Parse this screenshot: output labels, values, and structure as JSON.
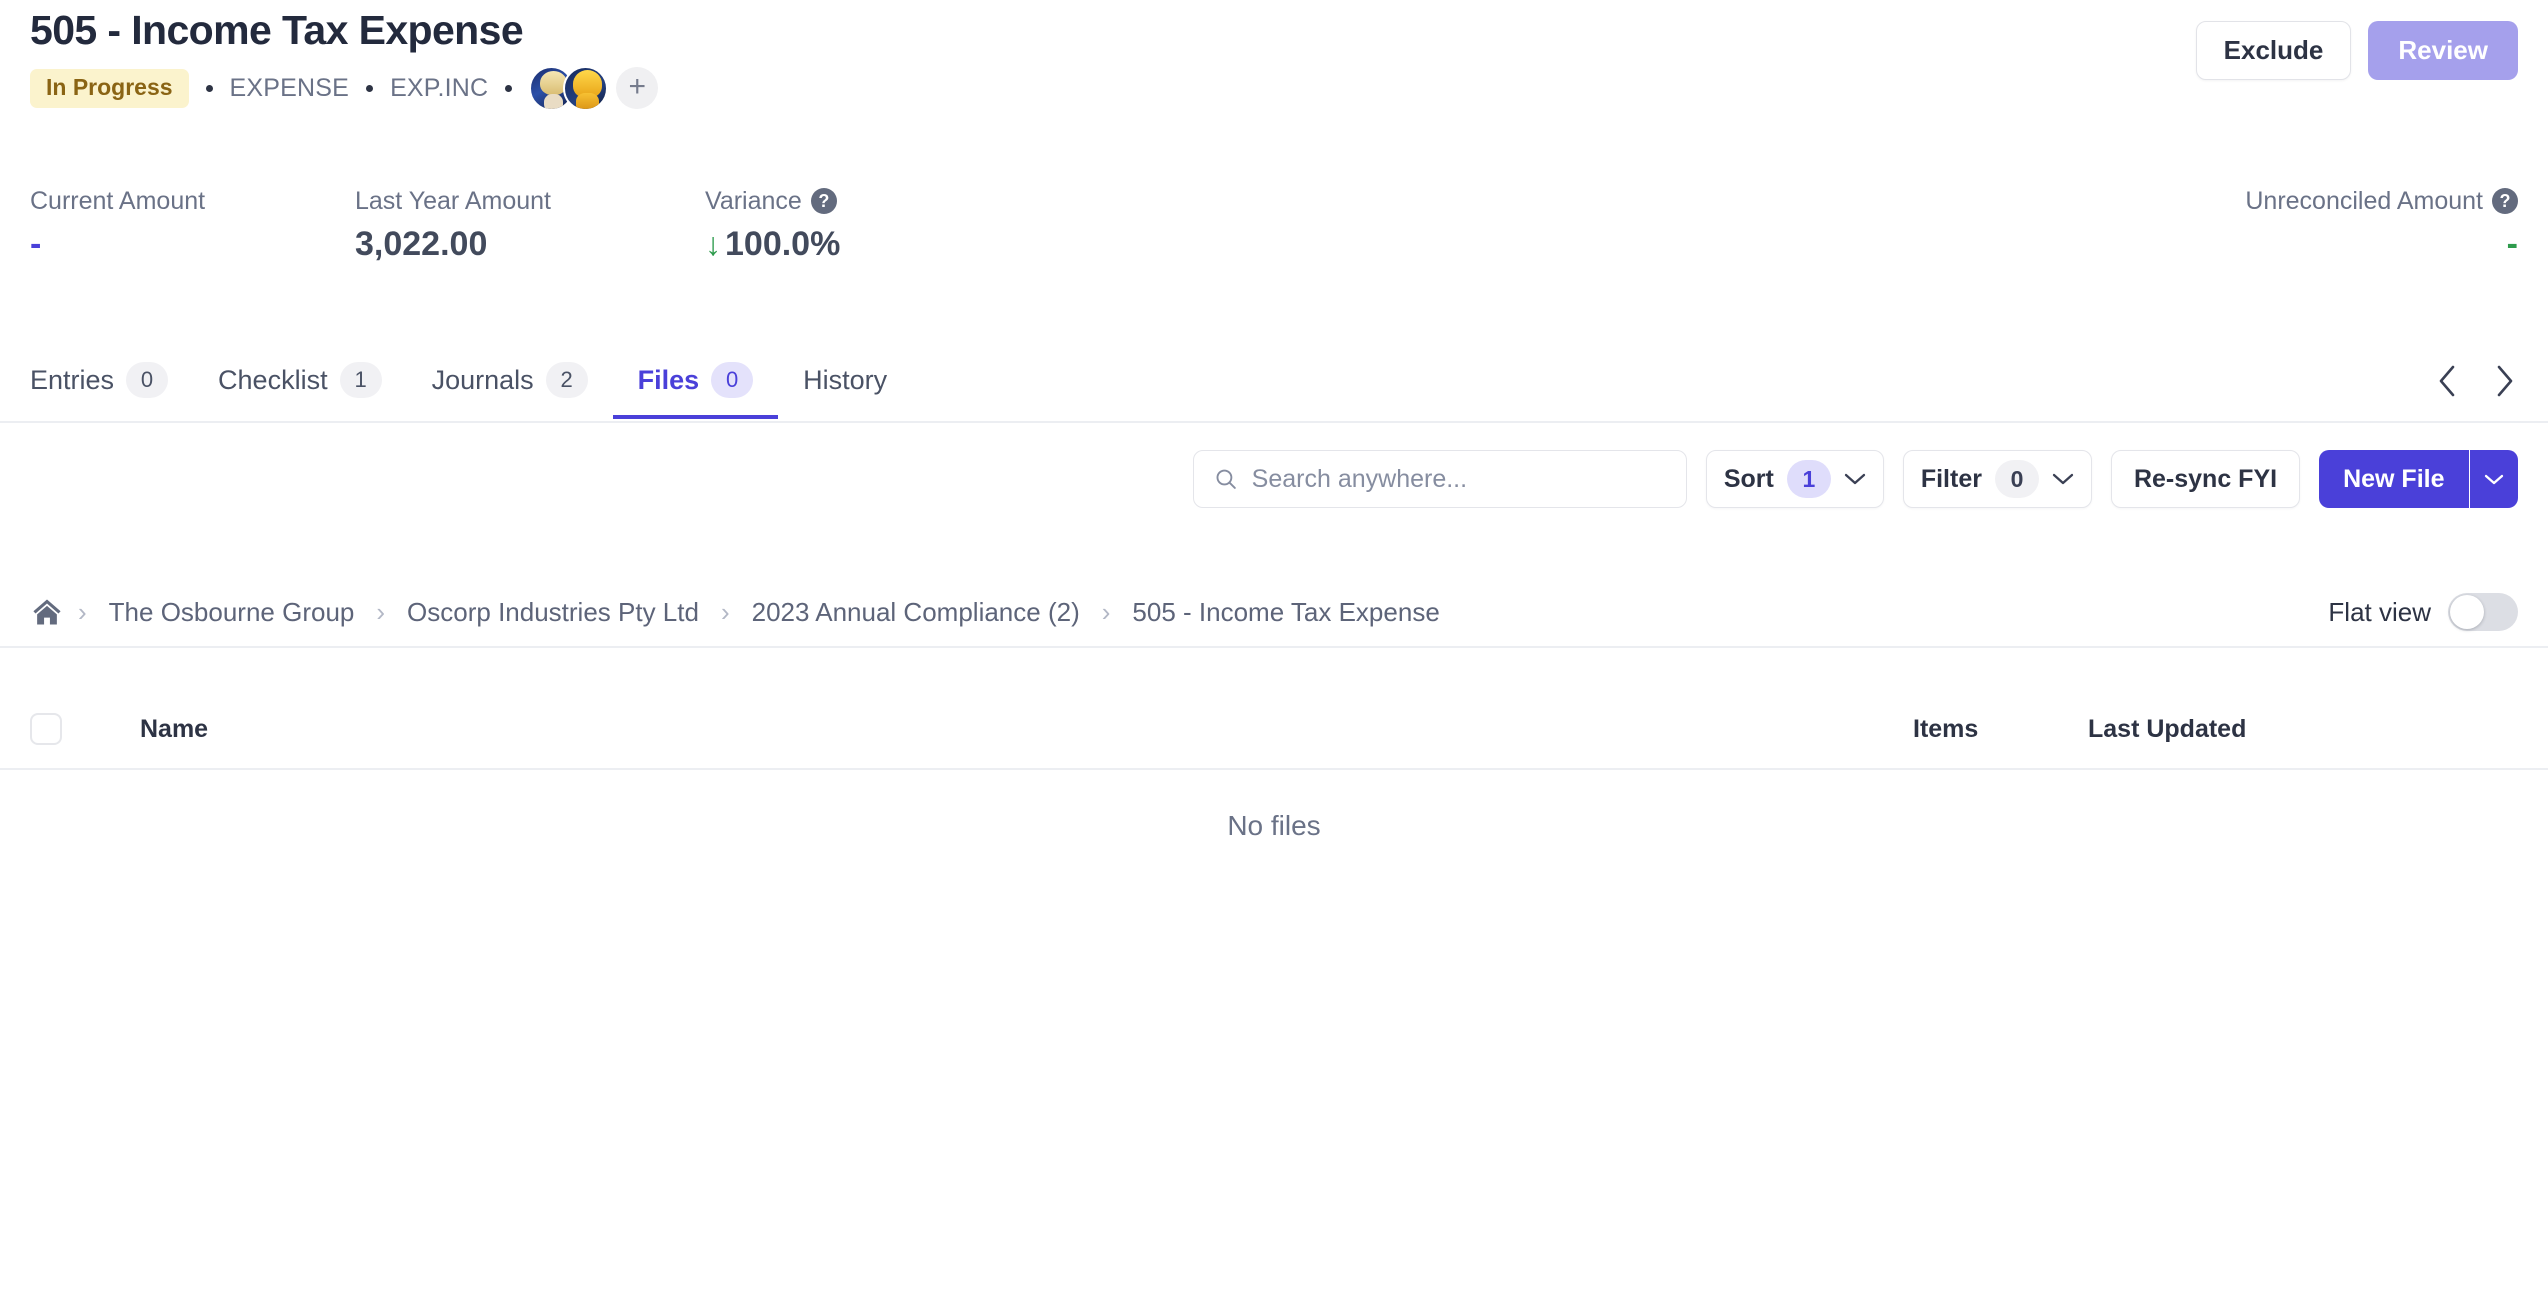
{
  "header": {
    "title": "505 - Income Tax Expense",
    "status_badge": "In Progress",
    "meta": [
      "EXPENSE",
      "EXP.INC"
    ],
    "add_member_label": "+",
    "actions": {
      "exclude_label": "Exclude",
      "review_label": "Review"
    }
  },
  "metrics": [
    {
      "label": "Current Amount",
      "value": "-",
      "has_help": false
    },
    {
      "label": "Last Year Amount",
      "value": "3,022.00",
      "has_help": false
    },
    {
      "label": "Variance",
      "value": "100.0%",
      "arrow": "↓",
      "has_help": true
    },
    {
      "label": "Unreconciled Amount",
      "value": "-",
      "has_help": true
    }
  ],
  "tabs": [
    {
      "label": "Entries",
      "count": "0",
      "active": false
    },
    {
      "label": "Checklist",
      "count": "1",
      "active": false
    },
    {
      "label": "Journals",
      "count": "2",
      "active": false
    },
    {
      "label": "Files",
      "count": "0",
      "active": true
    },
    {
      "label": "History",
      "count": null,
      "active": false
    }
  ],
  "toolbar": {
    "search_placeholder": "Search anywhere...",
    "search_value": "",
    "sort_label": "Sort",
    "sort_count": "1",
    "filter_label": "Filter",
    "filter_count": "0",
    "resync_label": "Re-sync FYI",
    "new_file_label": "New File"
  },
  "breadcrumb": {
    "items": [
      "The Osbourne Group",
      "Oscorp Industries Pty Ltd",
      "2023 Annual Compliance (2)",
      "505 - Income Tax Expense"
    ],
    "separator": "›",
    "flat_view_label": "Flat view",
    "flat_view_on": false
  },
  "table": {
    "columns": [
      "Name",
      "Items",
      "Last Updated"
    ],
    "rows": [],
    "empty_message": "No files"
  },
  "colors": {
    "accent": "#4a40d9",
    "accent_muted": "#a5a0ec",
    "badge_bg": "#fbf3cd",
    "badge_text": "#8a6414",
    "variance_arrow": "#2e9b4d",
    "unreconciled_value": "#2e9b4d",
    "text_muted": "#6a7287"
  }
}
